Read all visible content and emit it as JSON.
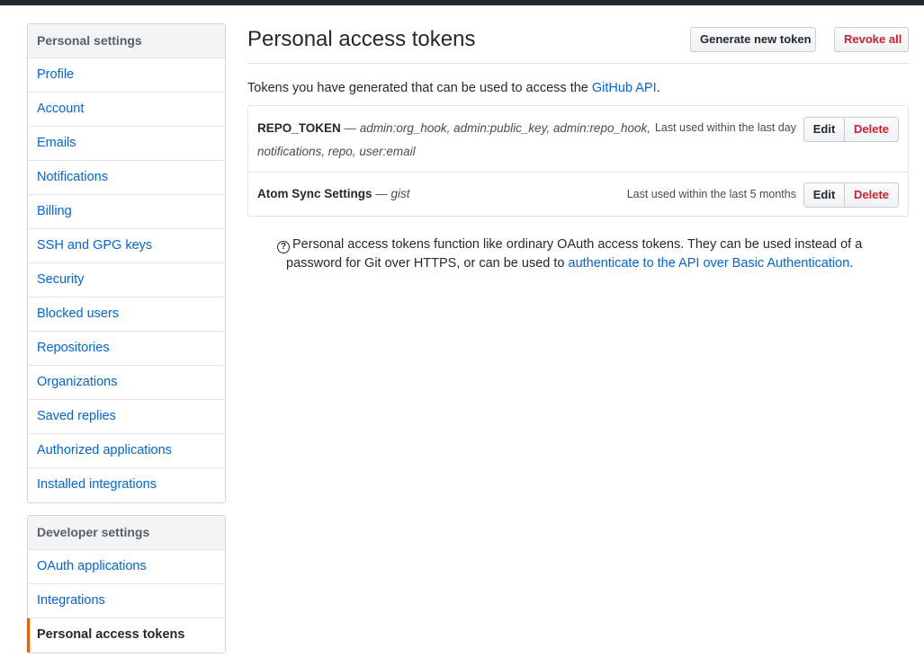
{
  "sidebar": {
    "personal_heading": "Personal settings",
    "personal_items": [
      {
        "label": "Profile"
      },
      {
        "label": "Account"
      },
      {
        "label": "Emails"
      },
      {
        "label": "Notifications"
      },
      {
        "label": "Billing"
      },
      {
        "label": "SSH and GPG keys"
      },
      {
        "label": "Security"
      },
      {
        "label": "Blocked users"
      },
      {
        "label": "Repositories"
      },
      {
        "label": "Organizations"
      },
      {
        "label": "Saved replies"
      },
      {
        "label": "Authorized applications"
      },
      {
        "label": "Installed integrations"
      }
    ],
    "developer_heading": "Developer settings",
    "developer_items": [
      {
        "label": "OAuth applications"
      },
      {
        "label": "Integrations"
      },
      {
        "label": "Personal access tokens",
        "selected": true
      }
    ]
  },
  "main": {
    "title": "Personal access tokens",
    "generate_label": "Generate new token",
    "revoke_label": "Revoke all",
    "intro_text": "Tokens you have generated that can be used to access the ",
    "intro_link": "GitHub API",
    "intro_end": ".",
    "tokens": [
      {
        "name": "REPO_TOKEN",
        "separator": " — ",
        "scopes_line1": "admin:org_hook, admin:public_key, admin:repo_hook,",
        "scopes_line2": "notifications, repo, user:email",
        "last_used": "Last used within the last day",
        "edit_label": "Edit",
        "delete_label": "Delete"
      },
      {
        "name": "Atom Sync Settings",
        "separator": " — ",
        "scopes_line1": "gist",
        "last_used": "Last used within the last 5 months",
        "edit_label": "Edit",
        "delete_label": "Delete"
      }
    ],
    "help": {
      "icon_glyph": "?",
      "line1": "Personal access tokens function like ordinary OAuth access tokens. They can be used instead of a",
      "line2_text": "password for Git over HTTPS, or can be used to ",
      "line2_link": "authenticate to the API over Basic Authentication",
      "line2_end": "."
    }
  },
  "colors": {
    "link": "#0366d6",
    "danger": "#cb2431",
    "selected_accent": "#e36209",
    "topbar": "#24292e"
  }
}
